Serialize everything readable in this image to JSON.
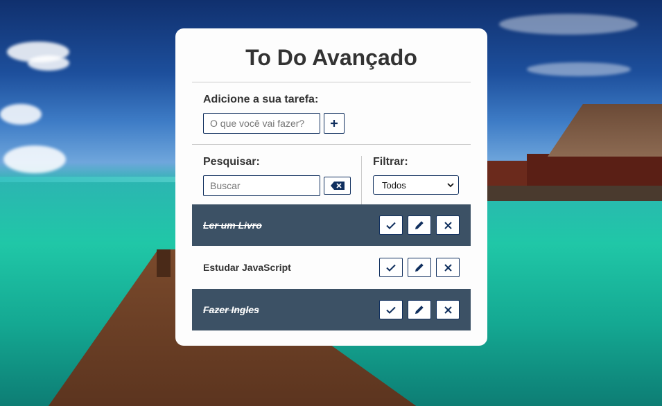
{
  "app": {
    "title": "To Do Avançado"
  },
  "add": {
    "label": "Adicione a sua tarefa:",
    "placeholder": "O que você vai fazer?",
    "button_icon": "plus-icon"
  },
  "search": {
    "label": "Pesquisar:",
    "placeholder": "Buscar",
    "clear_icon": "backspace-icon"
  },
  "filter": {
    "label": "Filtrar:",
    "selected": "Todos"
  },
  "todos": [
    {
      "text": "Ler um Livro",
      "done": true
    },
    {
      "text": "Estudar JavaScript",
      "done": false
    },
    {
      "text": "Fazer Ingles",
      "done": true
    }
  ],
  "colors": {
    "accent": "#102f5e",
    "done_background": "#3c5165",
    "card": "#fdfdfd"
  }
}
